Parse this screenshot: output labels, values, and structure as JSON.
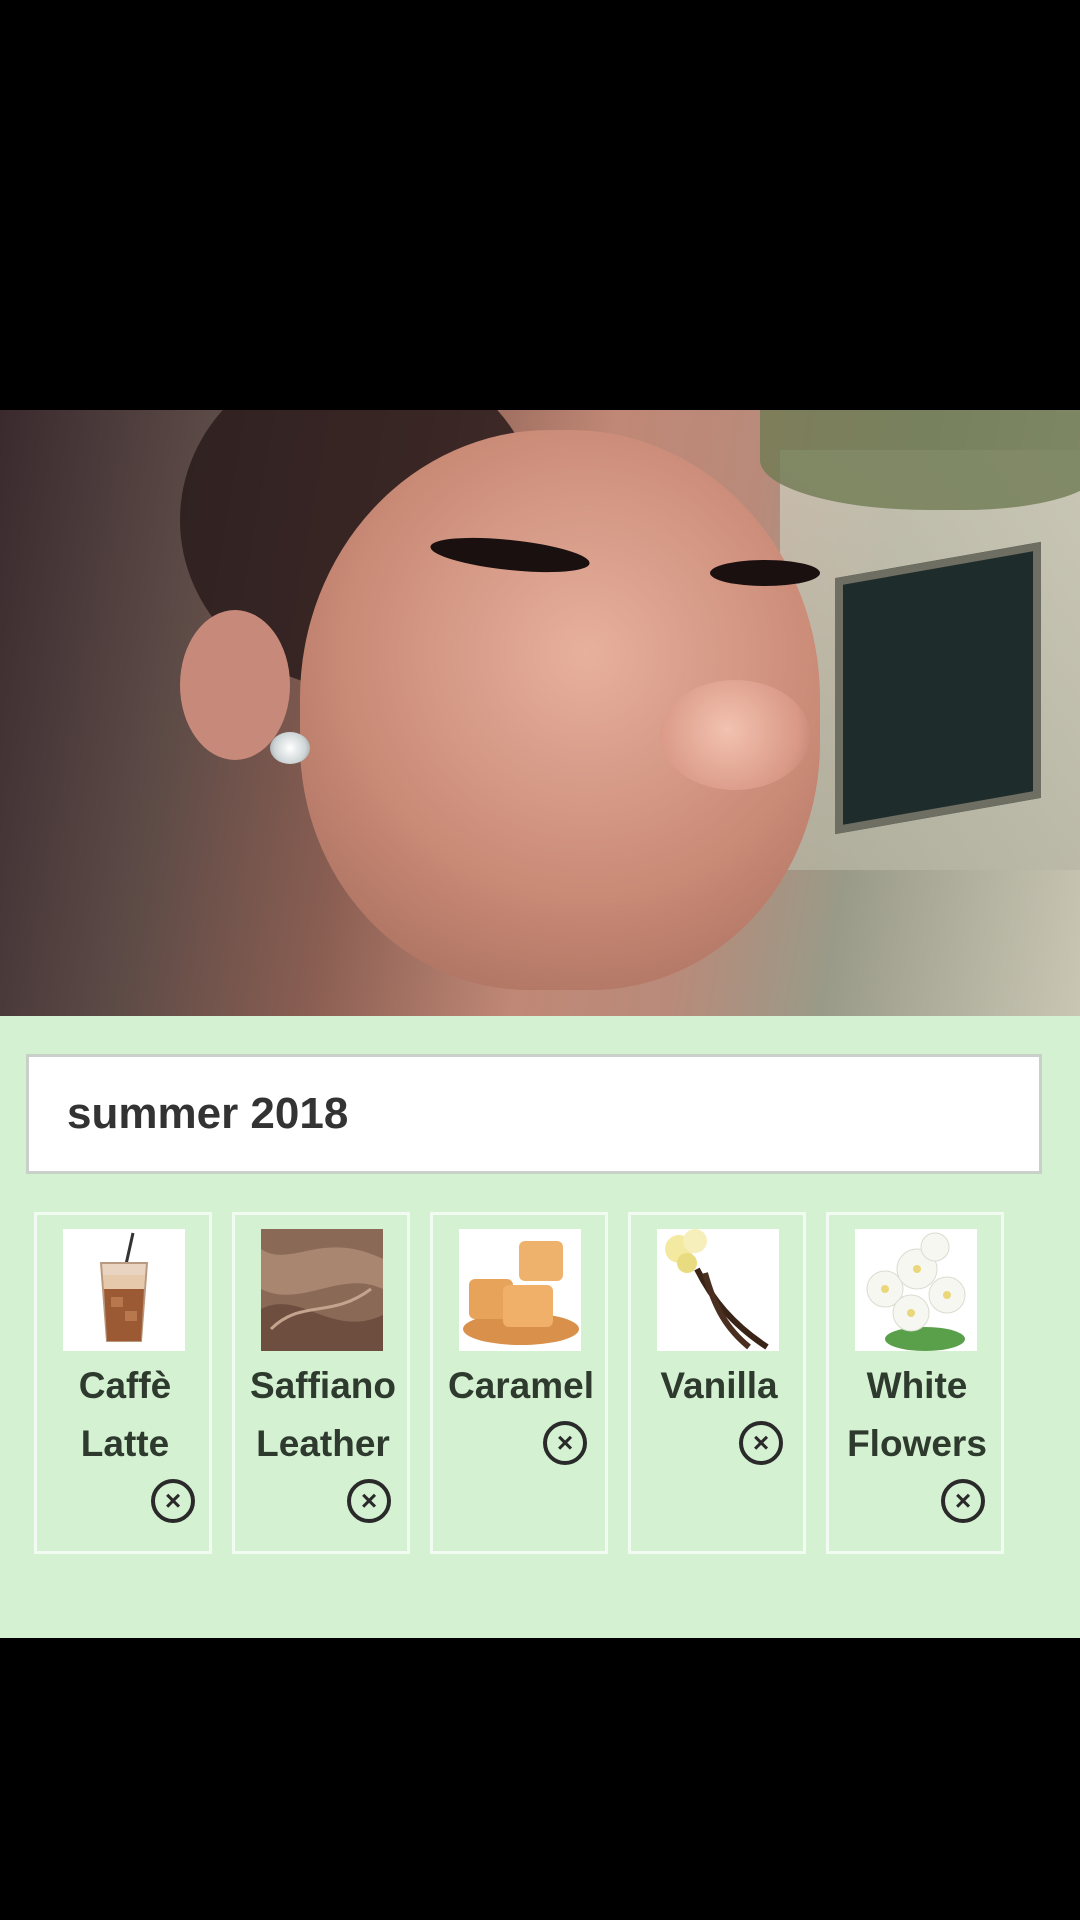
{
  "photo": {
    "description_icon": "photo"
  },
  "title_field": {
    "value": "summer 2018"
  },
  "notes": [
    {
      "label_line1": "Caffè",
      "label_line2": "Latte",
      "icon": "iced-coffee-icon"
    },
    {
      "label_line1": "Saffiano",
      "label_line2": "Leather",
      "icon": "leather-icon"
    },
    {
      "label_line1": "Caramel",
      "label_line2": "",
      "icon": "caramel-icon"
    },
    {
      "label_line1": "Vanilla",
      "label_line2": "",
      "icon": "vanilla-icon"
    },
    {
      "label_line1": "White",
      "label_line2": "Flowers",
      "icon": "white-flowers-icon"
    }
  ],
  "remove_glyph": "×",
  "colors": {
    "panel": "#d4f2d2",
    "field": "#ffffff",
    "text": "#333333"
  }
}
